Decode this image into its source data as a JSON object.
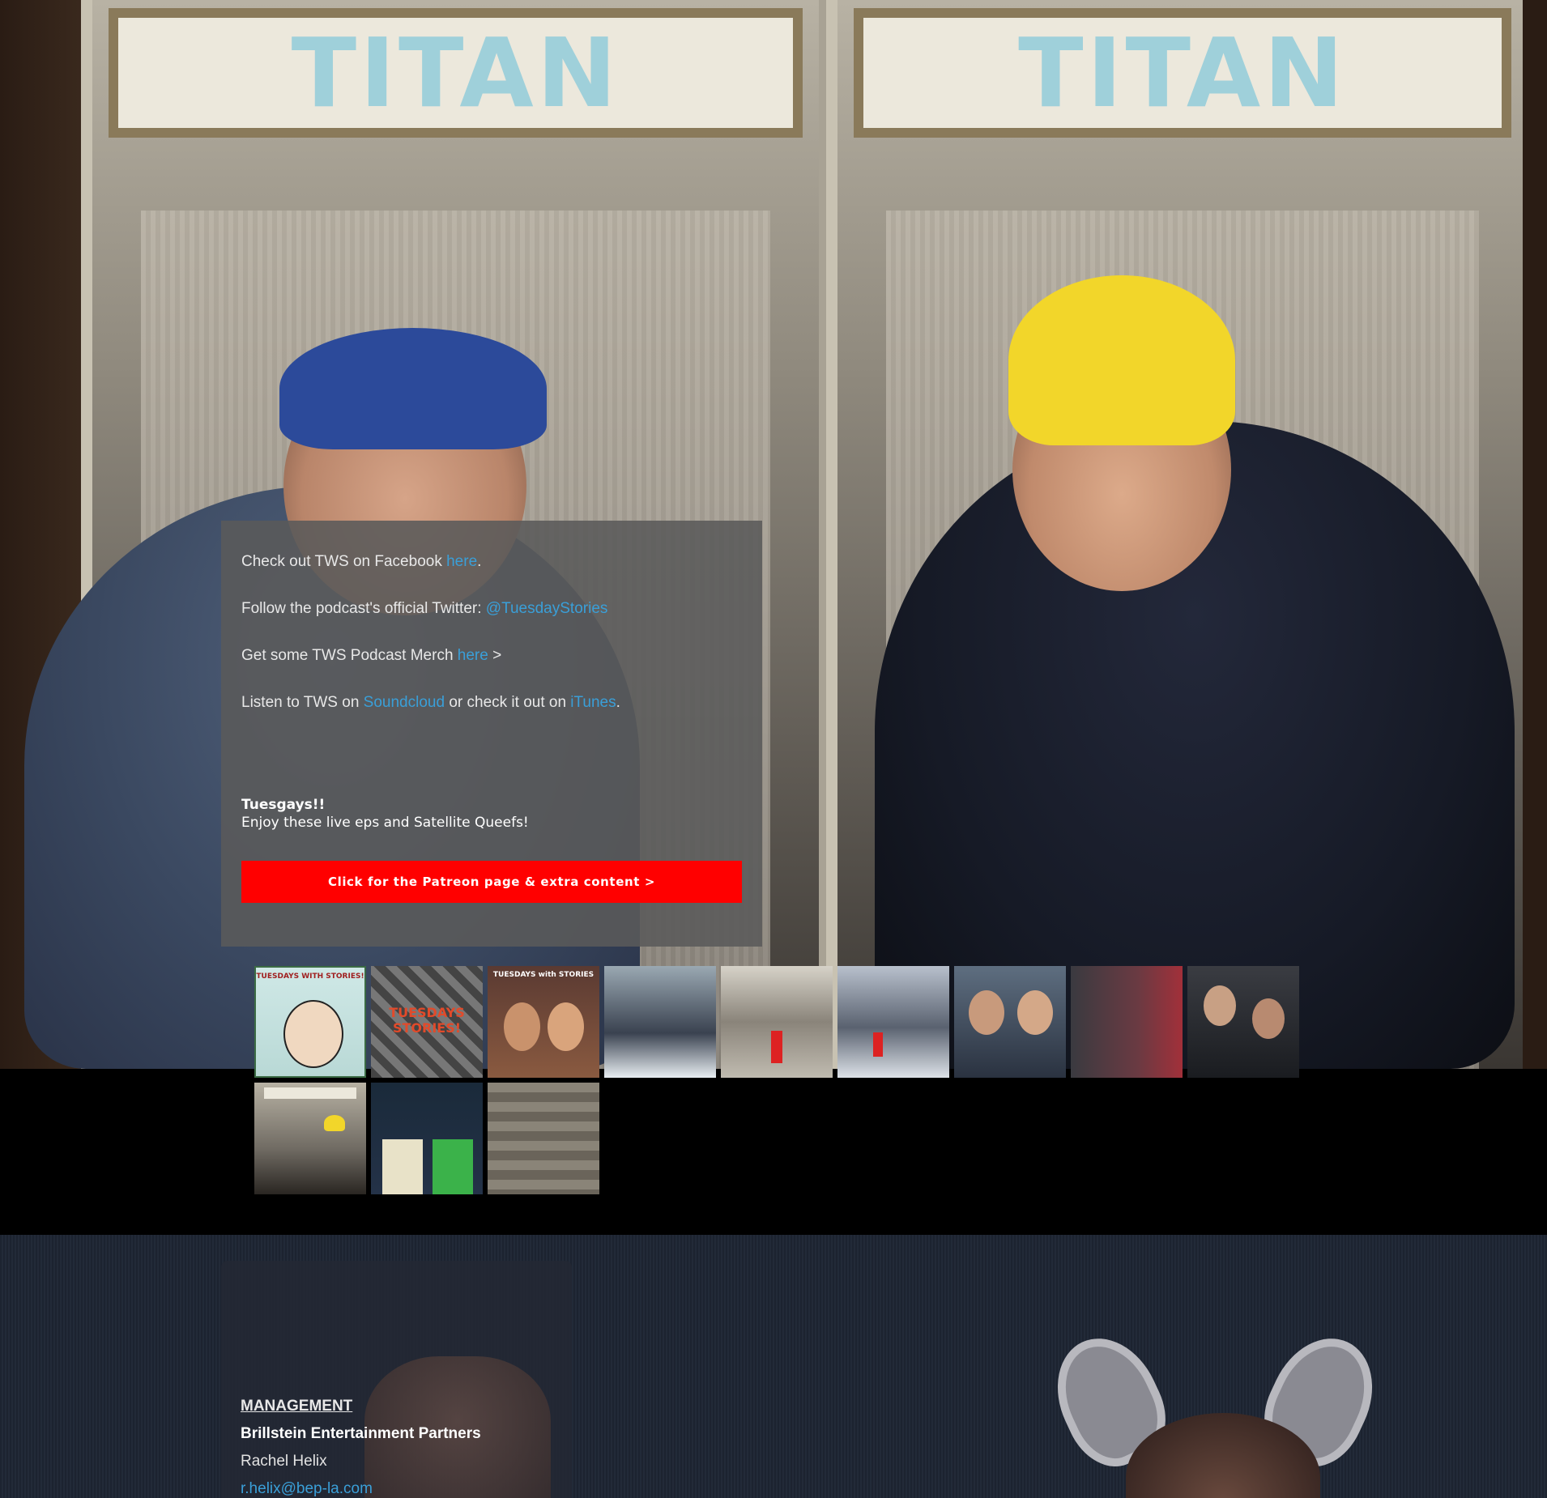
{
  "hero": {
    "sign_left": "TITAN",
    "sign_right": "TITAN"
  },
  "info": {
    "facebook_prefix": "Check out TWS on Facebook ",
    "facebook_link": "here",
    "facebook_suffix": ".",
    "twitter_prefix": "Follow the podcast's official Twitter: ",
    "twitter_link": "@TuesdayStories",
    "merch_prefix": "Get some TWS Podcast Merch ",
    "merch_link": "here",
    "merch_suffix": " >",
    "listen_prefix": "Listen to TWS on ",
    "soundcloud_link": "Soundcloud",
    "listen_middle": " or check it out on ",
    "itunes_link": "iTunes",
    "listen_suffix": ".",
    "tuesgays_title": "Tuesgays!!",
    "tuesgays_subtitle": "Enjoy these live eps and Satellite Queefs!",
    "patreon_button": "Click for the Patreon page & extra content >"
  },
  "gallery": {
    "thumb1_label": "TUESDAYS WITH STORIES!",
    "thumb2_label": "TUESDAYS STORIES!",
    "thumb3_label": "TUESDAYS with STORIES"
  },
  "management": {
    "heading": "MANAGEMENT",
    "company": "Brillstein Entertainment Partners",
    "name": "Rachel Helix",
    "email": "r.helix@bep-la.com"
  },
  "colors": {
    "link": "#3a9fd8",
    "button": "#ff0000",
    "panel": "#5a5a5a",
    "beanie": "#f2d62a",
    "cap": "#2c4a9a"
  }
}
